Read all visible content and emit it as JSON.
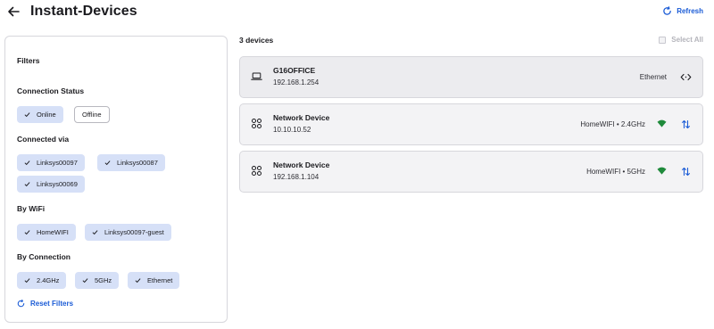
{
  "header": {
    "title": "Instant-Devices",
    "refresh_label": "Refresh"
  },
  "filters": {
    "heading": "Filters",
    "connection_status": {
      "title": "Connection Status",
      "chips": [
        {
          "label": "Online",
          "selected": true
        },
        {
          "label": "Offline",
          "selected": false
        }
      ]
    },
    "connected_via": {
      "title": "Connected via",
      "chips": [
        {
          "label": "Linksys00097",
          "selected": true
        },
        {
          "label": "Linksys00087",
          "selected": true
        },
        {
          "label": "Linksys00069",
          "selected": true
        }
      ]
    },
    "by_wifi": {
      "title": "By WiFi",
      "chips": [
        {
          "label": "HomeWIFI",
          "selected": true
        },
        {
          "label": "Linksys00097-guest",
          "selected": true
        }
      ]
    },
    "by_connection": {
      "title": "By Connection",
      "chips": [
        {
          "label": "2.4GHz",
          "selected": true
        },
        {
          "label": "5GHz",
          "selected": true
        },
        {
          "label": "Ethernet",
          "selected": true
        }
      ]
    },
    "reset_label": "Reset Filters"
  },
  "devices_header": {
    "count_label": "3 devices",
    "select_all_label": "Select All"
  },
  "devices": [
    {
      "name": "G16OFFICE",
      "ip": "192.168.1.254",
      "connection": "Ethernet",
      "icon": "laptop-icon",
      "right_icon": "ethernet-icon"
    },
    {
      "name": "Network Device",
      "ip": "10.10.10.52",
      "connection": "HomeWIFI • 2.4GHz",
      "icon": "device-grid-icon",
      "signal_icon": "wifi-icon",
      "right_icon": "transfer-icon"
    },
    {
      "name": "Network Device",
      "ip": "192.168.1.104",
      "connection": "HomeWIFI • 5GHz",
      "icon": "device-grid-icon",
      "signal_icon": "wifi-icon",
      "right_icon": "transfer-icon"
    }
  ],
  "colors": {
    "accent": "#1a5bd6",
    "chip_selected": "#d6e0f7",
    "wifi_signal": "#1f8a3b",
    "card_bg": "#f3f3f5"
  }
}
